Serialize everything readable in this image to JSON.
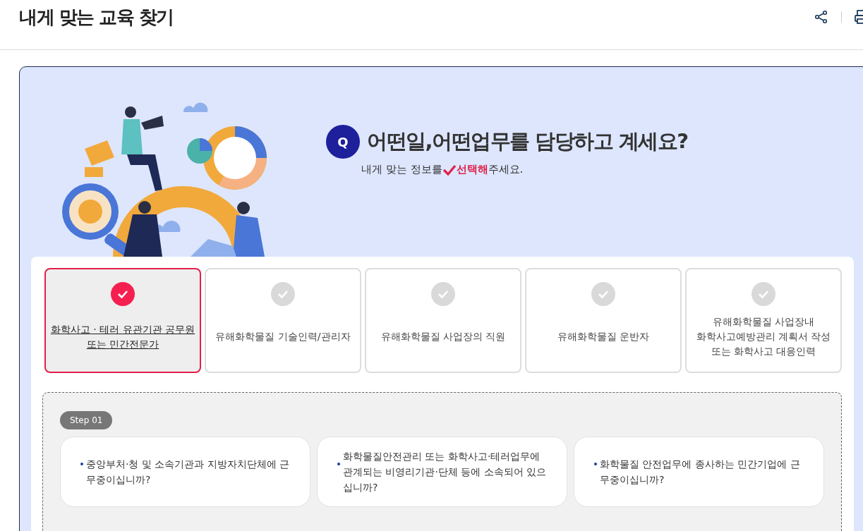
{
  "page_title": "내게 맞는 교육 찾기",
  "question": {
    "badge": "Q",
    "title": "어떤일,어떤업무를 담당하고 계세요?",
    "subtitle_before": "내게 맞는 정보를",
    "subtitle_highlight": "선택해",
    "subtitle_after": "주세요."
  },
  "roles": [
    {
      "label": "화학사고 · 테러 유관기관 공무원\n또는 민간전문가",
      "selected": true
    },
    {
      "label": "유해화학물질 기술인력/관리자",
      "selected": false
    },
    {
      "label": "유해화학물질 사업장의 직원",
      "selected": false
    },
    {
      "label": "유해화학물질 운반자",
      "selected": false
    },
    {
      "label": "유해화학물질 사업장내\n화학사고예방관리 계획서 작성\n또는 화학사고 대응인력",
      "selected": false
    }
  ],
  "step": {
    "badge": "Step 01",
    "options": [
      "중앙부처·청 및 소속기관과 지방자치단체에 근무중이십니까?",
      "화학물질안전관리 또는 화학사고·테러업무에 관계되는 비영리기관·단체 등에 소속되어 있으십니까?",
      "화학물질 안전업무에 종사하는 민간기업에 근무중이십니까?"
    ]
  }
}
